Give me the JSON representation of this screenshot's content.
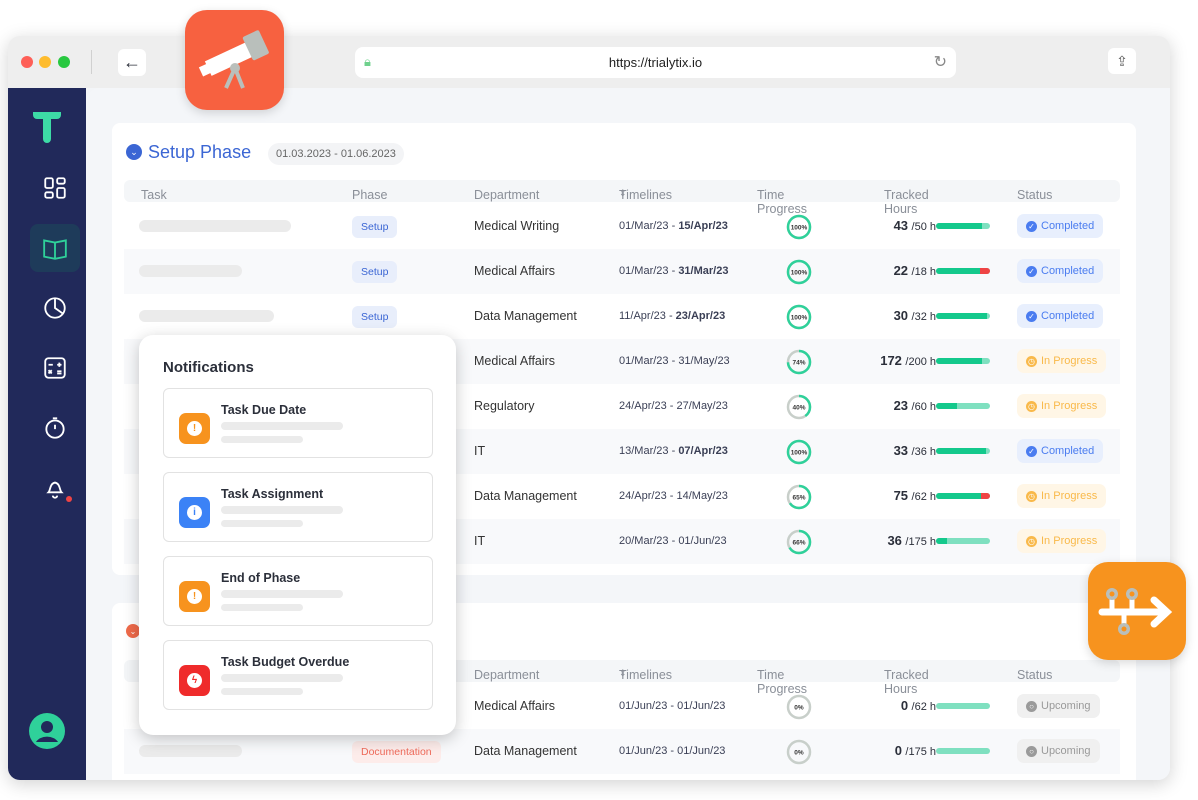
{
  "browser": {
    "url": "https://trialytix.io"
  },
  "colors": {
    "sidebar": "#21295a",
    "accent": "#2fd19a",
    "brand_blue": "#3b66d4",
    "telescope_app": "#f76140",
    "timeline_app": "#f7931e",
    "completed": "#4a7cf0",
    "in_progress": "#f9b94a",
    "upcoming": "#9a9a9a",
    "over_budget": "#ef4444"
  },
  "sidebar": {
    "items": [
      {
        "icon": "dashboard-grid-icon"
      },
      {
        "icon": "open-book-icon",
        "active": true
      },
      {
        "icon": "pie-chart-icon"
      },
      {
        "icon": "calculator-icon"
      },
      {
        "icon": "stopwatch-icon"
      },
      {
        "icon": "bell-icon",
        "badge": true
      }
    ],
    "user_icon": "user-avatar-icon"
  },
  "columns": {
    "task": "Task",
    "phase": "Phase",
    "department": "Department",
    "timelines": "Timelines",
    "sort": "⇕",
    "time_progress": "Time Progress",
    "tracked_hours": "Tracked Hours",
    "status": "Status"
  },
  "setup": {
    "title": "Setup Phase",
    "dates": "01.03.2023 - 01.06.2023",
    "rows": [
      {
        "phase": "Setup",
        "department": "Medical Writing",
        "start": "01/Mar/23",
        "end": "15/Apr/23",
        "end_bold": true,
        "progress": 100,
        "tracked": "43",
        "budget": "/50 h",
        "status": "Completed"
      },
      {
        "phase": "Setup",
        "department": "Medical Affairs",
        "start": "01/Mar/23",
        "end": "31/Mar/23",
        "end_bold": true,
        "progress": 100,
        "tracked": "22",
        "budget": "/18 h",
        "status": "Completed"
      },
      {
        "phase": "Setup",
        "department": "Data Management",
        "start": "11/Apr/23",
        "end": "23/Apr/23",
        "end_bold": true,
        "progress": 100,
        "tracked": "30",
        "budget": "/32 h",
        "status": "Completed"
      },
      {
        "phase": "",
        "department": "Medical Affairs",
        "start": "01/Mar/23",
        "end": "31/May/23",
        "end_bold": false,
        "progress": 74,
        "tracked": "172",
        "budget": "/200 h",
        "status": "In Progress"
      },
      {
        "phase": "",
        "department": "Regulatory",
        "start": "24/Apr/23",
        "end": "27/May/23",
        "end_bold": false,
        "progress": 40,
        "tracked": "23",
        "budget": "/60 h",
        "status": "In Progress"
      },
      {
        "phase": "",
        "department": "IT",
        "start": "13/Mar/23",
        "end": "07/Apr/23",
        "end_bold": true,
        "progress": 100,
        "tracked": "33",
        "budget": "/36 h",
        "status": "Completed"
      },
      {
        "phase": "",
        "department": "Data Management",
        "start": "24/Apr/23",
        "end": "14/May/23",
        "end_bold": false,
        "progress": 65,
        "tracked": "75",
        "budget": "/62 h",
        "status": "In Progress"
      },
      {
        "phase": "",
        "department": "IT",
        "start": "20/Mar/23",
        "end": "01/Jun/23",
        "end_bold": false,
        "progress": 66,
        "tracked": "36",
        "budget": "/175 h",
        "status": "In Progress"
      }
    ]
  },
  "documentation": {
    "rows": [
      {
        "phase": "",
        "department": "Medical Affairs",
        "start": "01/Jun/23",
        "end": "01/Jun/23",
        "end_bold": false,
        "progress": 0,
        "tracked": "0",
        "budget": "/62 h",
        "status": "Upcoming"
      },
      {
        "phase": "Documentation",
        "department": "Data Management",
        "start": "01/Jun/23",
        "end": "01/Jun/23",
        "end_bold": false,
        "progress": 0,
        "tracked": "0",
        "budget": "/175 h",
        "status": "Upcoming"
      }
    ]
  },
  "notifications": {
    "title": "Notifications",
    "items": [
      {
        "label": "Task Due Date",
        "icon": "warning-icon",
        "color": "#f7931e",
        "glyph": "!"
      },
      {
        "label": "Task Assignment",
        "icon": "info-icon",
        "color": "#3b82f6",
        "glyph": "i"
      },
      {
        "label": "End of Phase",
        "icon": "warning-icon",
        "color": "#f7931e",
        "glyph": "!"
      },
      {
        "label": "Task Budget Overdue",
        "icon": "alert-icon",
        "color": "#ef2b2b",
        "glyph": "ϟ"
      }
    ]
  }
}
